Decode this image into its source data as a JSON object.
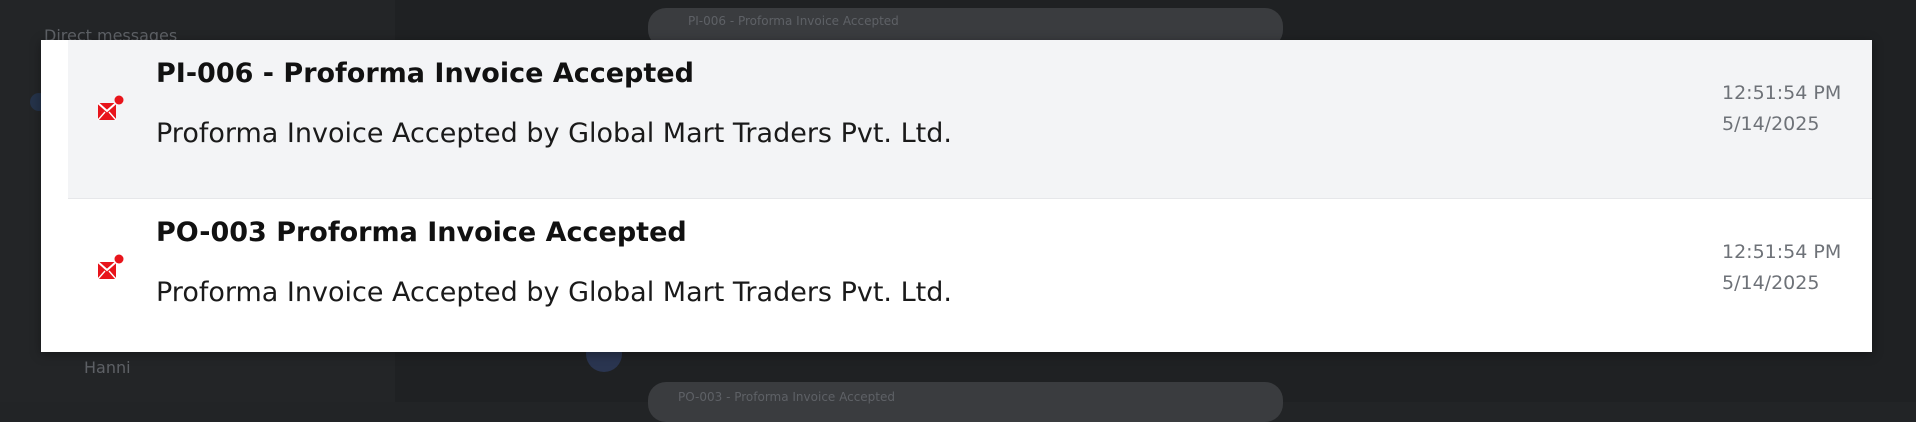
{
  "notifications": [
    {
      "title": "PI-006 - Proforma Invoice Accepted",
      "message": "Proforma Invoice Accepted by Global Mart Traders Pvt. Ltd.",
      "time": "12:51:54 PM",
      "date": "5/14/2025",
      "icon": "mail-notification-icon"
    },
    {
      "title": "PO-003 Proforma Invoice Accepted",
      "message": "Proforma Invoice Accepted by Global Mart Traders Pvt. Ltd.",
      "time": "12:51:54 PM",
      "date": "5/14/2025",
      "icon": "mail-notification-icon"
    }
  ],
  "background": {
    "sidebar_section": "Direct messages",
    "sidebar_user": "Hanni",
    "chat_preview_top": "PI-006 - Proforma Invoice Accepted",
    "chat_preview_bottom": "PO-003 - Proforma Invoice Accepted"
  },
  "colors": {
    "icon_red": "#e8141b",
    "overlay_bg": "#1f2123",
    "unread_row_bg": "#f3f4f6"
  }
}
